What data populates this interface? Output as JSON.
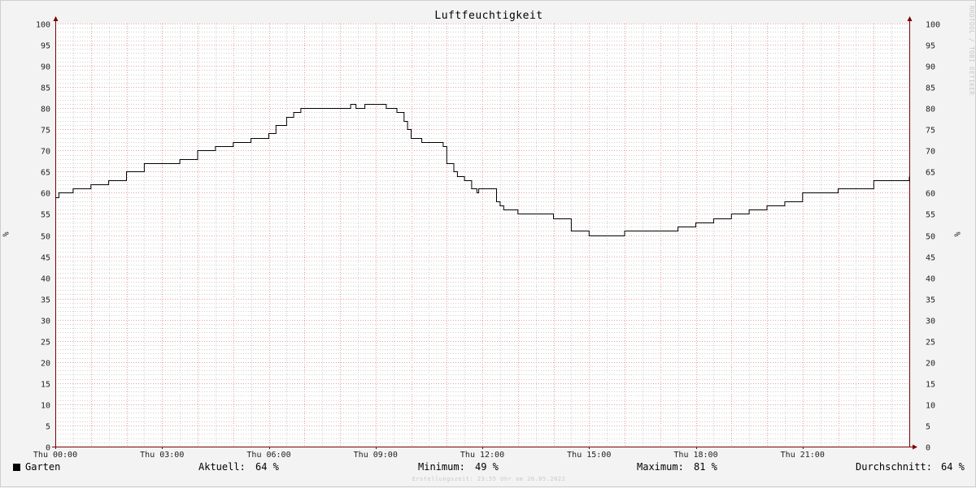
{
  "chart_data": {
    "type": "line",
    "title": "Luftfeuchtigkeit",
    "ylabel": "%",
    "ylim": [
      0,
      100
    ],
    "y_ticks": [
      0,
      5,
      10,
      15,
      20,
      25,
      30,
      35,
      40,
      45,
      50,
      55,
      60,
      65,
      70,
      75,
      80,
      85,
      90,
      95,
      100
    ],
    "x_tick_labels": [
      "Thu 00:00",
      "Thu 03:00",
      "Thu 06:00",
      "Thu 09:00",
      "Thu 12:00",
      "Thu 15:00",
      "Thu 18:00",
      "Thu 21:00"
    ],
    "x_range_hours": [
      0,
      24
    ],
    "grid": true,
    "series": [
      {
        "name": "Garten",
        "color": "#000000",
        "x_hours": [
          0.0,
          0.1,
          0.4,
          0.5,
          1.0,
          1.5,
          2.0,
          2.5,
          3.0,
          3.5,
          4.0,
          4.5,
          5.0,
          5.5,
          6.0,
          6.2,
          6.5,
          6.7,
          6.9,
          7.0,
          7.2,
          7.5,
          7.9,
          8.3,
          8.45,
          8.6,
          8.7,
          8.8,
          9.3,
          9.6,
          9.8,
          9.9,
          10.0,
          10.1,
          10.3,
          10.8,
          10.9,
          11.0,
          11.2,
          11.3,
          11.5,
          11.7,
          11.85,
          11.9,
          12.4,
          12.5,
          12.6,
          12.75,
          13.0,
          13.5,
          14.0,
          14.5,
          15.0,
          15.5,
          16.0,
          16.5,
          17.5,
          17.6,
          18.0,
          18.5,
          19.0,
          19.5,
          20.0,
          20.5,
          21.0,
          22.0,
          23.0,
          24.0
        ],
        "values": [
          59,
          60,
          60,
          61,
          62,
          63,
          65,
          67,
          67,
          68,
          70,
          71,
          72,
          73,
          74,
          76,
          78,
          79,
          80,
          80,
          80,
          80,
          80,
          81,
          80,
          80,
          81,
          81,
          80,
          79,
          77,
          75,
          73,
          73,
          72,
          72,
          71,
          67,
          65,
          64,
          63,
          61,
          60,
          61,
          58,
          57,
          56,
          56,
          55,
          55,
          54,
          51,
          50,
          50,
          51,
          51,
          52,
          52,
          53,
          54,
          55,
          56,
          57,
          58,
          60,
          61,
          63,
          64
        ]
      }
    ]
  },
  "legend": {
    "series_label": "Garten",
    "current_label": "Aktuell:",
    "current_value": "64 %",
    "min_label": "Minimum:",
    "min_value": "49 %",
    "max_label": "Maximum:",
    "max_value": "81 %",
    "avg_label": "Durchschnitt:",
    "avg_value": "64 %"
  },
  "watermark": "RRDTOOL / TOBI OETIKER",
  "footer": "Erstellungszeit: 23:55 Uhr am 26.05.2022",
  "colors": {
    "background": "#f3f3f3",
    "plot_background": "#ffffff",
    "major_grid": "#e8a0a0",
    "minor_grid": "#d0d0d0",
    "axis": "#7a0000",
    "line": "#000000"
  }
}
